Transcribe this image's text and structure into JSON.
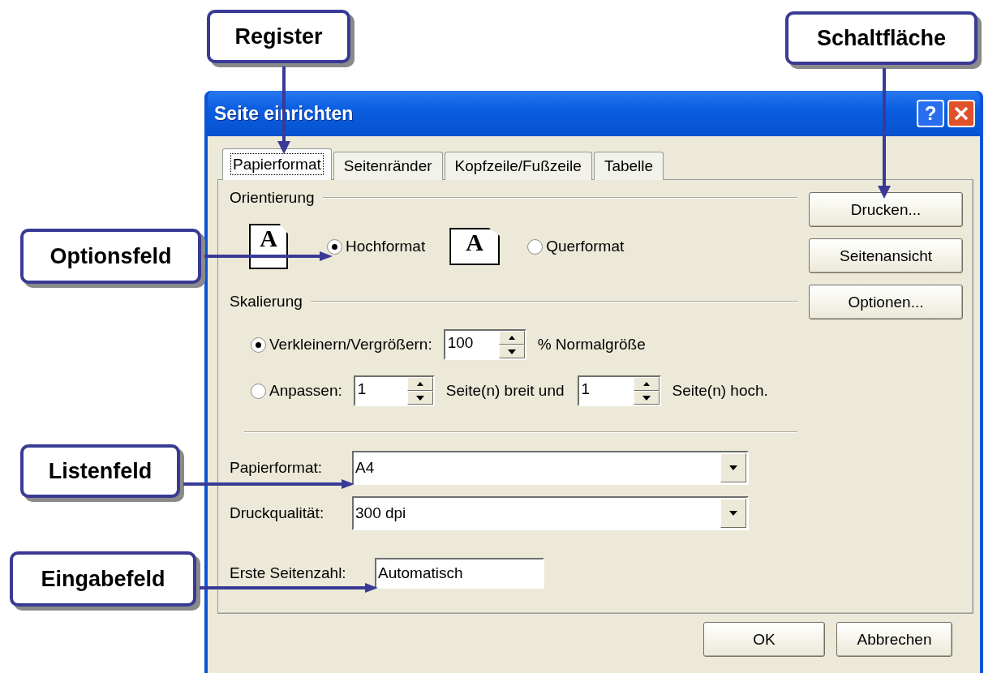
{
  "callouts": [
    {
      "label": "Register"
    },
    {
      "label": "Schaltfläche"
    },
    {
      "label": "Optionsfeld"
    },
    {
      "label": "Listenfeld"
    },
    {
      "label": "Eingabefeld"
    }
  ],
  "dialog": {
    "title": "Seite einrichten",
    "help_button": "?",
    "tabs": [
      {
        "label": "Papierformat",
        "selected": true
      },
      {
        "label": "Seitenränder",
        "selected": false
      },
      {
        "label": "Kopfzeile/Fußzeile",
        "selected": false
      },
      {
        "label": "Tabelle",
        "selected": false
      }
    ],
    "orientation": {
      "title": "Orientierung",
      "options": [
        {
          "kind": "portrait",
          "glyph": "A",
          "label": "Hochformat",
          "selected": true
        },
        {
          "kind": "landscape",
          "glyph": "A",
          "label": "Querformat",
          "selected": false
        }
      ]
    },
    "scaling": {
      "title": "Skalierung",
      "options": [
        {
          "kind": "percent",
          "label": "Verkleinern/Vergrößern:",
          "value": "100",
          "suffix": "% Normalgröße",
          "selected": true
        },
        {
          "kind": "fit",
          "label": "Anpassen:",
          "wide_value": "1",
          "wide_suffix": "Seite(n) breit und",
          "tall_value": "1",
          "tall_suffix": "Seite(n) hoch.",
          "selected": false
        }
      ]
    },
    "paper_size": {
      "label": "Papierformat:",
      "value": "A4"
    },
    "print_quality": {
      "label": "Druckqualität:",
      "value": "300 dpi"
    },
    "first_page_number": {
      "label": "Erste Seitenzahl:",
      "value": "Automatisch"
    },
    "side_buttons": [
      "Drucken...",
      "Seitenansicht",
      "Optionen..."
    ],
    "footer_buttons": [
      "OK",
      "Abbrechen"
    ]
  }
}
